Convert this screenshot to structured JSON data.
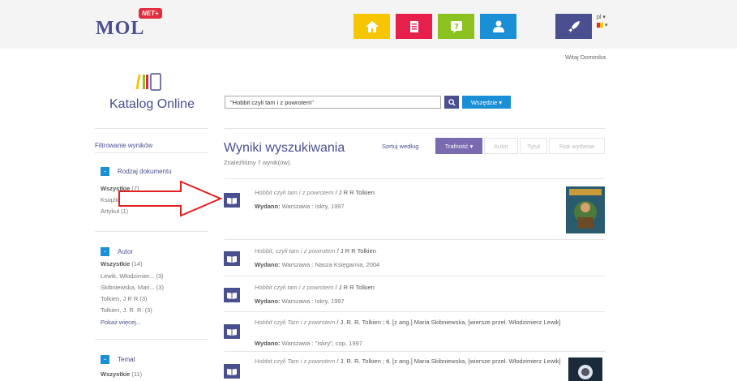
{
  "header": {
    "logo": "MOL",
    "logo_badge": "NET+",
    "language": "pl",
    "tiles": [
      {
        "icon": "home-icon",
        "color": "#f7c600"
      },
      {
        "icon": "clipboard-icon",
        "color": "#e6204a"
      },
      {
        "icon": "help-icon",
        "color": "#8cc21f"
      },
      {
        "icon": "user-icon",
        "color": "#1a8fd6"
      },
      {
        "icon": "rocket-icon",
        "color": "#4a4f8f"
      }
    ]
  },
  "greeting": "Witaj Dominika",
  "catalog": {
    "title": "Katalog Online",
    "search_value": "\"Hobbit czyli tam i z powrotem\"",
    "scope_label": "Wszędzie ▾"
  },
  "sidebar": {
    "title": "Filtrowanie wyników",
    "facets": [
      {
        "head": "Rodzaj dokumentu",
        "items": [
          {
            "label": "Wszystkie",
            "count": "(7)",
            "bold": true
          },
          {
            "label": "Książki",
            "count": "",
            "bold": false
          },
          {
            "label": "Artykuł",
            "count": "(1)",
            "bold": false
          }
        ],
        "more": ""
      },
      {
        "head": "Autor",
        "items": [
          {
            "label": "Wszystkie",
            "count": "(14)",
            "bold": true
          },
          {
            "label": "Lewik, Włodzimier...",
            "count": "(3)",
            "bold": false
          },
          {
            "label": "Skibniewska, Mari...",
            "count": "(3)",
            "bold": false
          },
          {
            "label": "Tolkien, J R R",
            "count": "(3)",
            "bold": false
          },
          {
            "label": "Tolkien, J. R. R.",
            "count": "(3)",
            "bold": false
          }
        ],
        "more": "Pokaż więcej..."
      },
      {
        "head": "Temat",
        "items": [
          {
            "label": "Wszystkie",
            "count": "(11)",
            "bold": true
          }
        ],
        "more": ""
      }
    ]
  },
  "results": {
    "title": "Wyniki wyszukiwania",
    "count": "Znaleźliśmy 7 wynik(ów).",
    "sort_label": "Sortuj według",
    "sort_options": [
      {
        "label": "Trafność ▾",
        "active": true
      },
      {
        "label": "Autor",
        "active": false
      },
      {
        "label": "Tytuł",
        "active": false
      },
      {
        "label": "Rok wydania",
        "active": false
      }
    ],
    "items": [
      {
        "title": "Hobbit czyli tam i z powrotem",
        "author": " / J R R Tolkien",
        "pub_label": "Wydano:",
        "pub": " Warszawa : Iskry, 1997",
        "cover": true
      },
      {
        "title": "Hobbit, czyli tam i z powrotem",
        "author": " / J R R Tolkien",
        "pub_label": "Wydano:",
        "pub": " Warszawa : Nasza Księgarnia, 2004",
        "cover": false
      },
      {
        "title": "Hobbit czyli tam i z powrotem",
        "author": " / J R R Tolkien",
        "pub_label": "Wydano:",
        "pub": " Warszawa : Iskry, 1997",
        "cover": false
      },
      {
        "title": "Hobbit czyli Tam i z powrotem",
        "author": " / J. R. R. Tolkien ; tł. [z ang.] Maria Skibniewska, [wiersze przeł. Włodzimierz Lewik]",
        "pub_label": "Wydano:",
        "pub": " Warszawa : \"Iskry\", cop. 1997",
        "cover": false
      },
      {
        "title": "Hobbit czyli Tam i z powrotem",
        "author": " / J. R. R. Tolkien ; tł. [z ang.] Maria Skibniewska, [wiersze przeł. Włodzimierz Lewik]",
        "pub_label": "",
        "pub": "",
        "cover": true
      }
    ]
  }
}
